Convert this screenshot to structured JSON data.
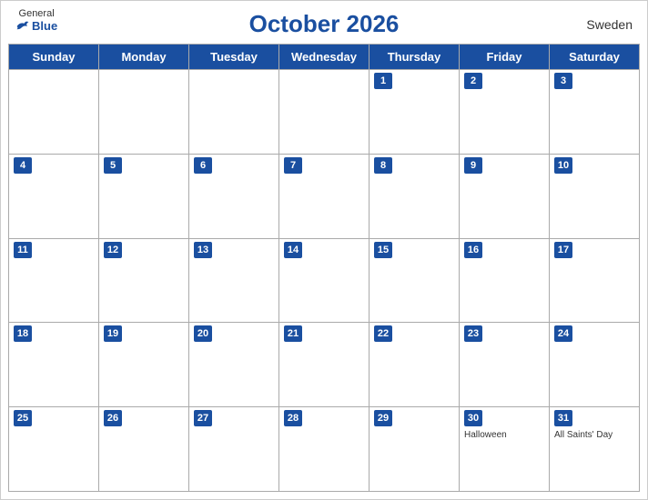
{
  "header": {
    "title": "October 2026",
    "country": "Sweden",
    "logo": {
      "general": "General",
      "blue": "Blue"
    }
  },
  "day_headers": [
    "Sunday",
    "Monday",
    "Tuesday",
    "Wednesday",
    "Thursday",
    "Friday",
    "Saturday"
  ],
  "weeks": [
    [
      {
        "num": "",
        "events": []
      },
      {
        "num": "",
        "events": []
      },
      {
        "num": "",
        "events": []
      },
      {
        "num": "",
        "events": []
      },
      {
        "num": "1",
        "events": []
      },
      {
        "num": "2",
        "events": []
      },
      {
        "num": "3",
        "events": []
      }
    ],
    [
      {
        "num": "4",
        "events": []
      },
      {
        "num": "5",
        "events": []
      },
      {
        "num": "6",
        "events": []
      },
      {
        "num": "7",
        "events": []
      },
      {
        "num": "8",
        "events": []
      },
      {
        "num": "9",
        "events": []
      },
      {
        "num": "10",
        "events": []
      }
    ],
    [
      {
        "num": "11",
        "events": []
      },
      {
        "num": "12",
        "events": []
      },
      {
        "num": "13",
        "events": []
      },
      {
        "num": "14",
        "events": []
      },
      {
        "num": "15",
        "events": []
      },
      {
        "num": "16",
        "events": []
      },
      {
        "num": "17",
        "events": []
      }
    ],
    [
      {
        "num": "18",
        "events": []
      },
      {
        "num": "19",
        "events": []
      },
      {
        "num": "20",
        "events": []
      },
      {
        "num": "21",
        "events": []
      },
      {
        "num": "22",
        "events": []
      },
      {
        "num": "23",
        "events": []
      },
      {
        "num": "24",
        "events": []
      }
    ],
    [
      {
        "num": "25",
        "events": []
      },
      {
        "num": "26",
        "events": []
      },
      {
        "num": "27",
        "events": []
      },
      {
        "num": "28",
        "events": []
      },
      {
        "num": "29",
        "events": []
      },
      {
        "num": "30",
        "events": [
          "Halloween"
        ]
      },
      {
        "num": "31",
        "events": [
          "All Saints' Day"
        ]
      }
    ]
  ],
  "colors": {
    "header_bg": "#1a4fa0",
    "header_text": "#ffffff",
    "title_color": "#1a4fa0"
  }
}
